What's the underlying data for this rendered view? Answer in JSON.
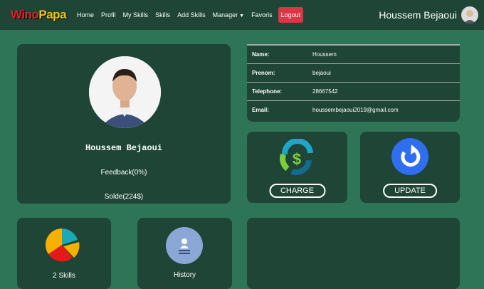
{
  "nav": {
    "logo_part1": "Wino",
    "logo_part2": "Papa",
    "items": [
      "Home",
      "Profil",
      "My Skills",
      "Skills",
      "Add Skills",
      "Manager",
      "Favoris"
    ],
    "logout": "Logout",
    "user": "Houssem Bejaoui"
  },
  "profile": {
    "name": "Houssem Bejaoui",
    "feedback": "Feedback(0%)",
    "solde": "Solde(224$)"
  },
  "info": [
    {
      "k": "Name:",
      "v": "Houssem"
    },
    {
      "k": "Prenom:",
      "v": "bejaoui"
    },
    {
      "k": "Telephone:",
      "v": "28667542"
    },
    {
      "k": "Email:",
      "v": "houssembejaoui2019@gmail.com"
    }
  ],
  "actions": {
    "charge": "CHARGE",
    "update": "UPDATE"
  },
  "tiles": {
    "skills": "2 Skills",
    "history": "History"
  }
}
